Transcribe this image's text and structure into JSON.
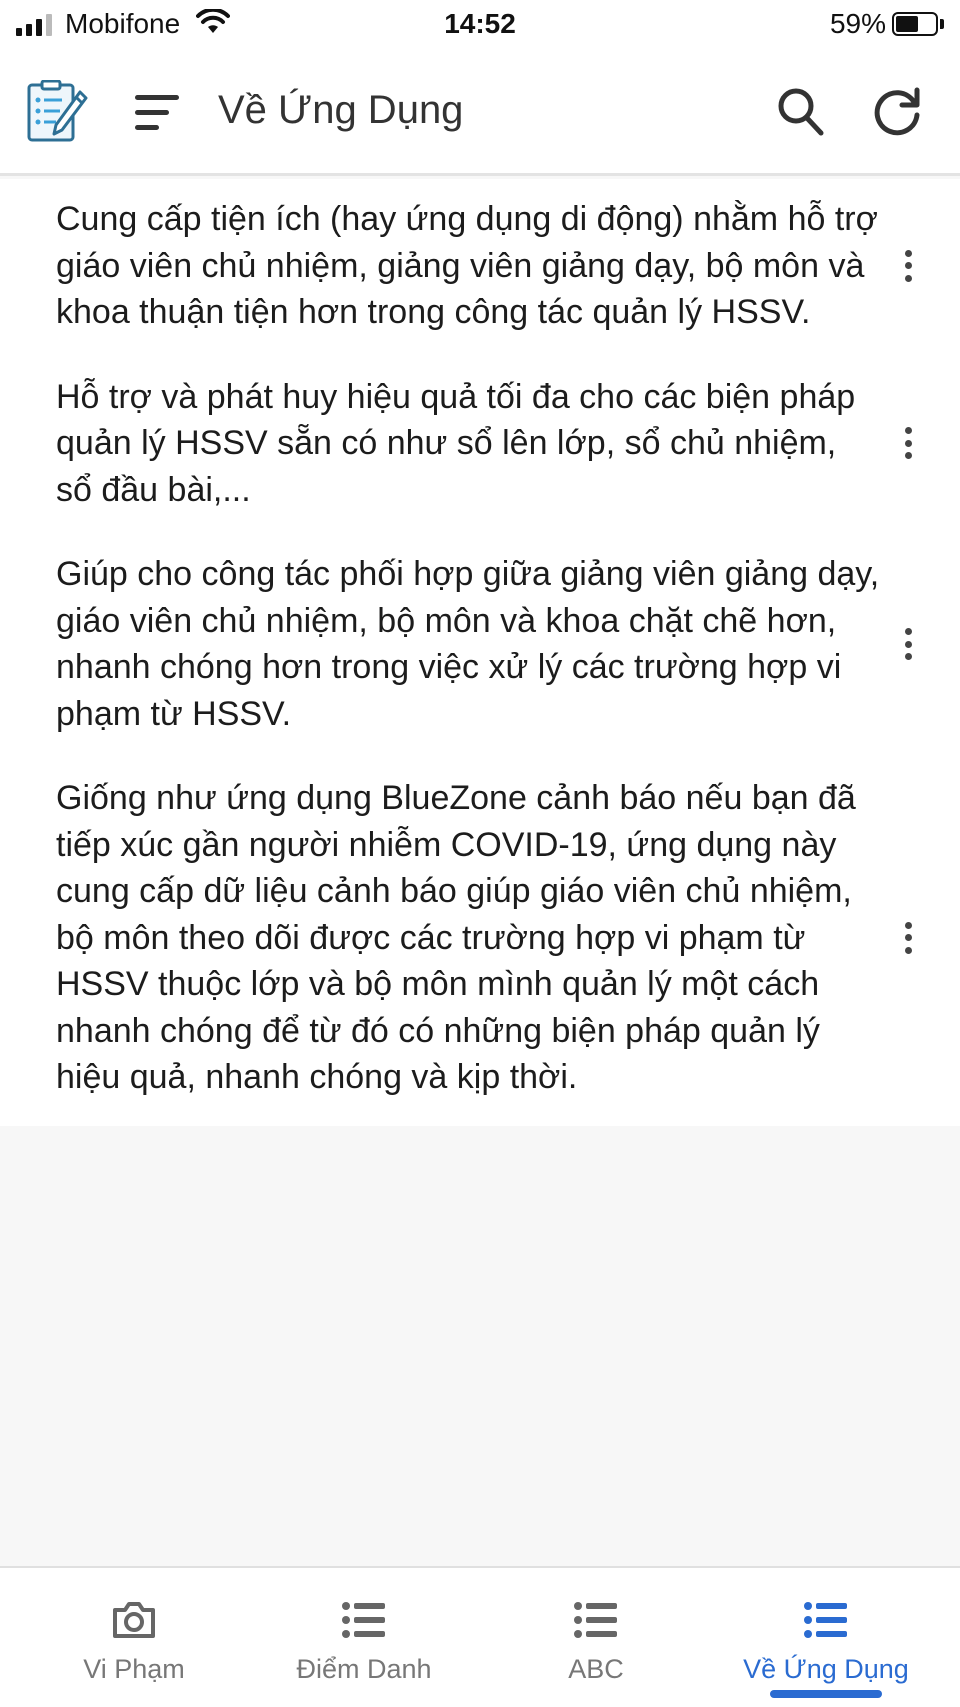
{
  "status_bar": {
    "carrier": "Mobifone",
    "time": "14:52",
    "battery_percent_text": "59%",
    "battery_level": 0.59,
    "signal_bars_filled": 3,
    "signal_bars_total": 4
  },
  "header": {
    "title": "Về Ứng Dụng",
    "logo_icon": "checklist-document-icon",
    "menu_icon": "sort-menu-icon",
    "search_icon": "search-icon",
    "refresh_icon": "refresh-icon"
  },
  "content": {
    "paragraphs": [
      {
        "text": "Cung cấp tiện ích (hay ứng dụng di động) nhằm hỗ trợ giáo viên chủ nhiệm, giảng viên giảng dạy, bộ môn và khoa thuận tiện hơn trong công tác quản lý HSSV."
      },
      {
        "text": "Hỗ trợ và phát huy hiệu quả tối đa cho các biện pháp quản lý HSSV sẵn có như sổ lên lớp, sổ chủ nhiệm, sổ đầu bài,..."
      },
      {
        "text": "Giúp cho công tác phối hợp giữa giảng viên giảng dạy, giáo viên chủ nhiệm, bộ môn và khoa chặt chẽ hơn, nhanh chóng hơn trong việc xử lý các trường hợp vi phạm từ HSSV."
      },
      {
        "text": "Giống như ứng dụng BlueZone cảnh báo nếu bạn đã tiếp xúc gần người nhiễm COVID-19, ứng dụng này cung cấp dữ liệu cảnh báo giúp giáo viên chủ nhiệm, bộ môn theo dõi được các trường hợp vi phạm từ HSSV thuộc lớp và bộ môn mình quản lý một cách nhanh chóng để từ đó có những biện pháp quản lý hiệu quả, nhanh chóng và kịp thời."
      }
    ]
  },
  "tabs": [
    {
      "label": "Vi Phạm",
      "icon": "camera-icon",
      "active": false
    },
    {
      "label": "Điểm Danh",
      "icon": "list-icon",
      "active": false
    },
    {
      "label": "ABC",
      "icon": "list-icon",
      "active": false
    },
    {
      "label": "Về Ứng Dụng",
      "icon": "list-icon",
      "active": true
    }
  ],
  "colors": {
    "accent": "#2a6bd1",
    "inactive_tab": "#777777",
    "background": "#f7f7f7"
  }
}
